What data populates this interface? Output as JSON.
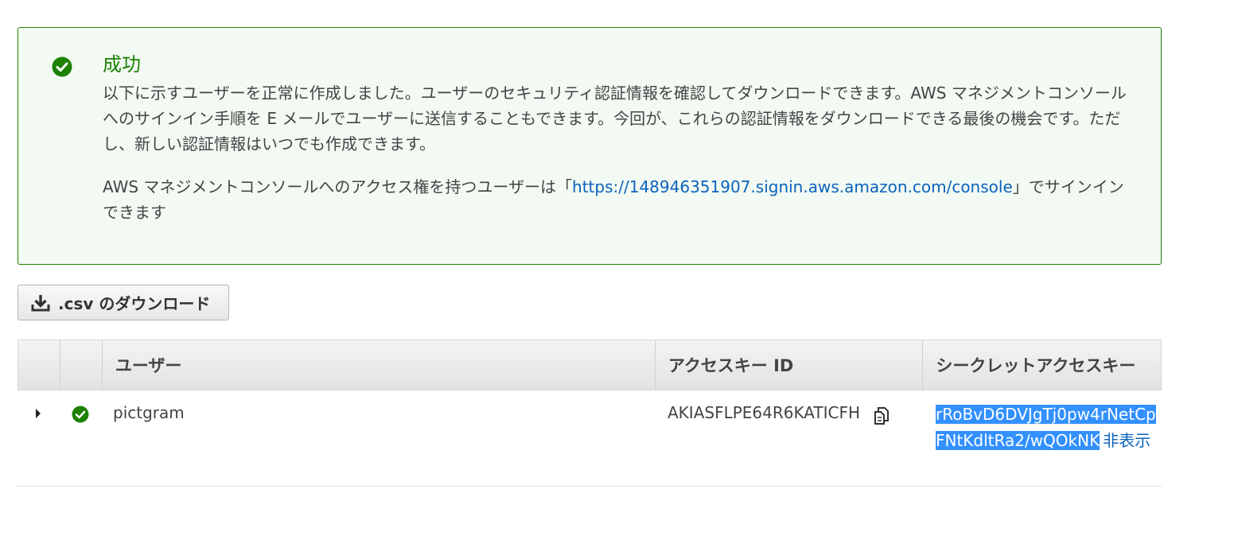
{
  "alert": {
    "title": "成功",
    "message": "以下に示すユーザーを正常に作成しました。ユーザーのセキュリティ認証情報を確認してダウンロードできます。AWS マネジメントコンソールへのサインイン手順を E メールでユーザーに送信することもできます。今回が、これらの認証情報をダウンロードできる最後の機会です。ただし、新しい認証情報はいつでも作成できます。",
    "signin_prefix": "AWS マネジメントコンソールへのアクセス権を持つユーザーは「",
    "signin_url": "https://148946351907.signin.aws.amazon.com/console",
    "signin_suffix": "」でサインインできます",
    "status_icon": "check-circle-icon",
    "color": "#1d8102"
  },
  "toolbar": {
    "download_label": ".csv のダウンロード",
    "download_icon": "download-icon"
  },
  "table": {
    "headers": {
      "user": "ユーザー",
      "access_key_id": "アクセスキー ID",
      "secret_access_key": "シークレットアクセスキー"
    },
    "rows": [
      {
        "user": "pictgram",
        "access_key_id": "AKIASFLPE64R6KATICFH",
        "secret_access_key": "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",
        "hide_label": "非表示",
        "status_icon": "check-circle-icon",
        "expand_icon": "caret-right-icon",
        "copy_icon": "copy-icon"
      }
    ]
  },
  "colors": {
    "success": "#1d8102",
    "link": "#0b63bd",
    "selection": "#3390ff"
  }
}
